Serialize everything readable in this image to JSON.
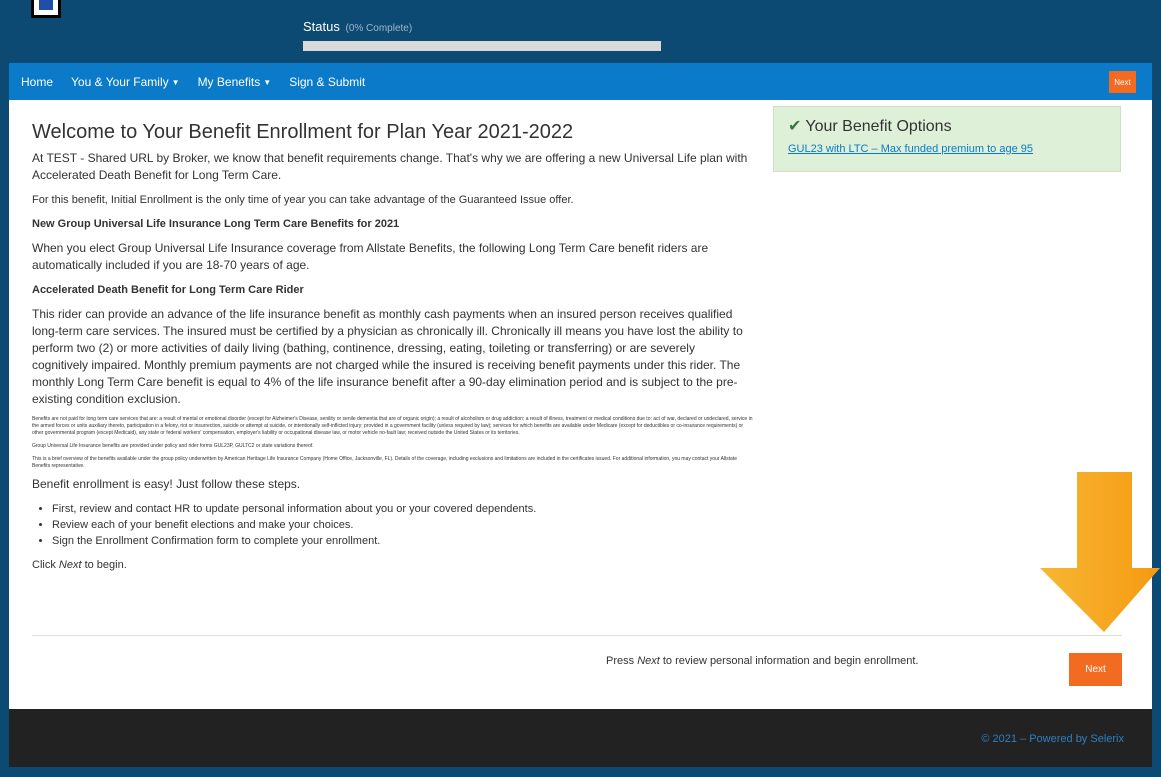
{
  "header": {
    "status_label": "Status",
    "status_pct": "(0% Complete)",
    "progress": 0
  },
  "nav": {
    "home": "Home",
    "family": "You & Your Family",
    "benefits": "My Benefits",
    "sign": "Sign & Submit",
    "next": "Next"
  },
  "main": {
    "title": "Welcome to Your Benefit Enrollment for Plan Year 2021-2022",
    "intro": "At TEST - Shared URL by Broker, we know that benefit requirements change. That's why we are offering a new Universal Life plan with Accelerated Death Benefit for Long Term Care.",
    "initial": "For this benefit, Initial Enrollment is the only time of year you can take advantage of the Guaranteed Issue offer.",
    "heading1": "New Group Universal Life Insurance Long Term Care Benefits for 2021",
    "para1": "When you elect Group Universal Life Insurance coverage from Allstate Benefits, the following Long Term Care benefit riders are automatically included if you are 18-70 years of age.",
    "heading2": "Accelerated Death Benefit for Long Term Care Rider",
    "para2": "This rider can provide an advance of the life insurance benefit as monthly cash payments when an insured person receives qualified long-term care services. The insured must be certified by a physician as chronically ill. Chronically ill means you have lost the ability to perform two (2) or more activities of daily living (bathing, continence, dressing, eating, toileting or transferring) or are severely cognitively impaired. Monthly premium payments are not charged while the insured is receiving benefit payments under this rider. The monthly Long Term Care benefit is equal to 4% of the life insurance benefit after a 90-day elimination period and is subject to the pre-existing condition exclusion.",
    "fine1": "Benefits are not paid for long term care services that are: a result of mental or emotional disorder (except for Alzheimer's Disease, senility or senile dementia that are of organic origin); a result of alcoholism or drug addiction; a result of illness, treatment or medical conditions due to: act of war, declared or undeclared, service in the armed forces or units auxiliary thereto, participation in a felony, riot or insurrection, suicide or attempt at suicide, or intentionally self-inflicted injury; provided in a government facility (unless required by law); services for which benefits are available under Medicare (except for deductibles or co-insurance requirements) or other governmental program (except Medicaid), any state or federal workers' compensation, employer's liability or occupational disease law, or motor vehicle no-fault law; received outside the United States or its territories.",
    "fine2": "Group Universal Life Insurance benefits are provided under policy and rider forms GUL23P, GULTC2 or state variations thereof.",
    "fine3": "This is a brief overview of the benefits available under the group policy underwritten by American Heritage Life Insurance Company (Home Office, Jacksonville, FL). Details of the coverage, including exclusions and limitations are included in the certificates issued. For additional information, you may contact your Allstate Benefits representative.",
    "easy": "Benefit enrollment is easy! Just follow these steps.",
    "steps": [
      "First, review and contact HR to update personal information about you or your covered dependents.",
      "Review each of your benefit elections and make your choices.",
      "Sign the Enrollment Confirmation form to complete your enrollment."
    ],
    "click_prefix": "Click ",
    "click_em": "Next",
    "click_suffix": " to begin."
  },
  "sidebar": {
    "title": "Your Benefit Options",
    "link": "GUL23 with LTC – Max funded premium to age 95"
  },
  "footer_action": {
    "instr_prefix": "Press ",
    "instr_em": "Next",
    "instr_suffix": " to review personal information and begin enrollment.",
    "next": "Next"
  },
  "footer": {
    "copyright": "© 2021 – Powered by Selerix"
  },
  "colors": {
    "header_bg": "#0d4a73",
    "nav_bg": "#0a7ac9",
    "accent_orange": "#f26b21",
    "arrow": "#f7a21b"
  }
}
